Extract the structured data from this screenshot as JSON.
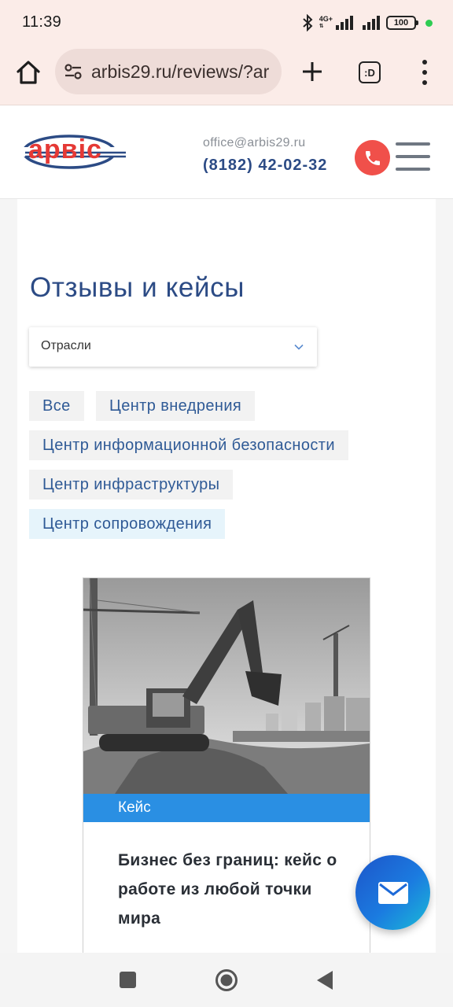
{
  "status_bar": {
    "time": "11:39",
    "network": "4G+",
    "battery": "100"
  },
  "browser": {
    "url": "arbis29.ru/reviews/?ar",
    "tabs_label": ":D",
    "icons": [
      "home-icon",
      "site-settings-icon",
      "plus-icon",
      "tabs-icon",
      "more-vert-icon"
    ]
  },
  "header": {
    "logo_text": "арвіс",
    "email": "office@arbis29.ru",
    "phone": "(8182) 42-02-32",
    "phone_button_color": "#f0504a"
  },
  "page": {
    "title": "Отзывы и кейсы",
    "filter": {
      "selected": "Отрасли"
    },
    "chips": [
      {
        "label": "Все",
        "active": false
      },
      {
        "label": "Центр внедрения",
        "active": false
      },
      {
        "label": "Центр информационной безопасности",
        "active": false
      },
      {
        "label": "Центр инфраструктуры",
        "active": false
      },
      {
        "label": "Центр сопровождения",
        "active": true
      }
    ],
    "case": {
      "tag": "Кейс",
      "title": "Бизнес без границ: кейс о работе из любой точки мира",
      "tag_color": "#2a8fe3"
    }
  },
  "colors": {
    "brand_blue": "#2c4b85",
    "brand_red": "#e53935",
    "fab_gradient_start": "#1d55c9",
    "fab_gradient_end": "#1bbbd7"
  }
}
